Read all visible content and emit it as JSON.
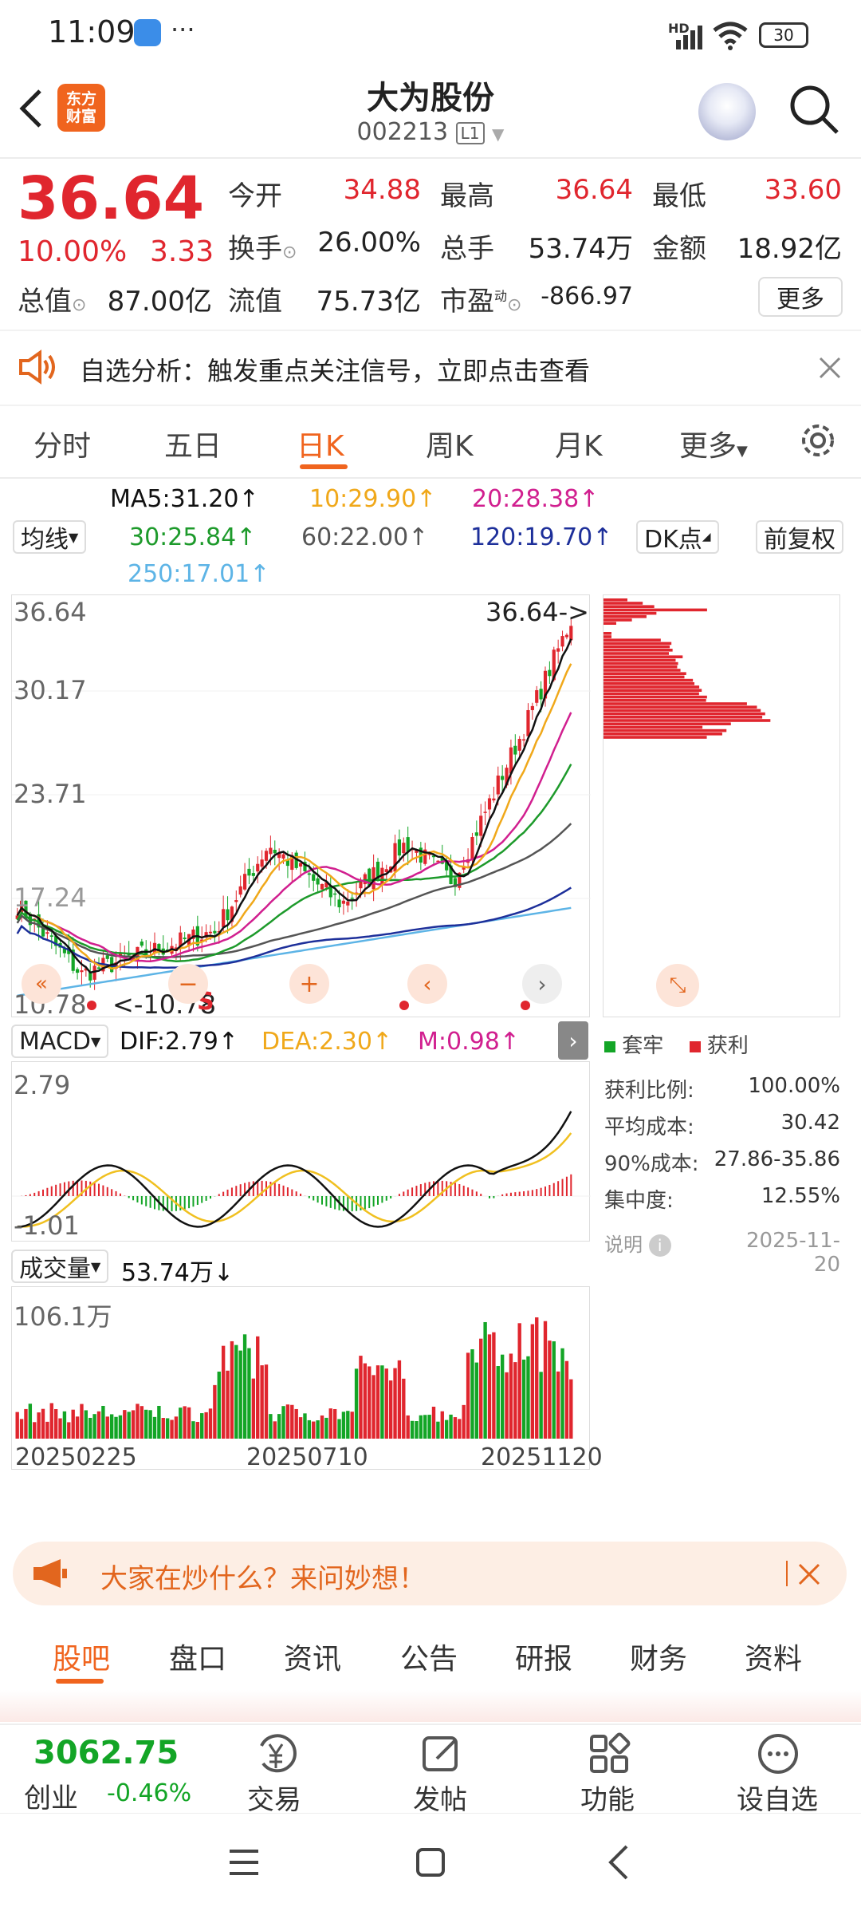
{
  "status_bar": {
    "time": "11:09",
    "more_dots": "···",
    "signal_label": "HD",
    "battery": "30"
  },
  "header": {
    "back_icon": "chevron-left-icon",
    "logo_line1": "东方",
    "logo_line2": "财富",
    "title": "大为股份",
    "code": "002213",
    "level_badge": "L1"
  },
  "quote": {
    "price": "36.64",
    "change_pct": "10.00%",
    "change": "3.33",
    "open_label": "今开",
    "open": "34.88",
    "high_label": "最高",
    "high": "36.64",
    "low_label": "最低",
    "low": "33.60",
    "turnover_label": "换手",
    "turnover": "26.00%",
    "volume_label": "总手",
    "volume": "53.74万",
    "amount_label": "金额",
    "amount": "18.92亿",
    "mcap_label": "总值",
    "mcap": "87.00亿",
    "float_label": "流值",
    "float_mcap": "75.73亿",
    "pe_label": "市盈",
    "pe_sup": "动",
    "pe": "-866.97",
    "more_label": "更多"
  },
  "banner": {
    "text": "自选分析：触发重点关注信号，立即点击查看"
  },
  "chart_tabs": {
    "items": [
      "分时",
      "五日",
      "日K",
      "周K",
      "月K",
      "更多"
    ],
    "active": "日K"
  },
  "ma_legend": {
    "selector": "均线",
    "ma5": "MA5:31.20↑",
    "ma10": "10:29.90↑",
    "ma20": "20:28.38↑",
    "ma30": "30:25.84↑",
    "ma60": "60:22.00↑",
    "ma120": "120:19.70↑",
    "ma250": "250:17.01↑",
    "dk_label": "DK点",
    "adjust_label": "前复权"
  },
  "kline": {
    "price_labels": [
      "36.64",
      "30.17",
      "23.71",
      "17.24",
      "10.78"
    ],
    "last_price_tag": "36.64->",
    "low_marker": "<-10.78",
    "signal_s": "S"
  },
  "chips": {
    "legend_trapped": "套牢",
    "legend_profit": "获利",
    "rows": [
      {
        "label": "获利比例:",
        "value": "100.00%"
      },
      {
        "label": "平均成本:",
        "value": "30.42"
      },
      {
        "label": "90%成本:",
        "value": "27.86-35.86"
      },
      {
        "label": "集中度:",
        "value": "12.55%"
      }
    ],
    "note_label": "说明",
    "date": "2025-11-20"
  },
  "macd": {
    "selector": "MACD",
    "dif": "DIF:2.79↑",
    "dea": "DEA:2.30↑",
    "m": "M:0.98↑",
    "top": "2.79",
    "bottom": "-1.01"
  },
  "volume": {
    "selector": "成交量",
    "value": "53.74万↓",
    "max_label": "106.1万",
    "dates": [
      "20250225",
      "20250710",
      "20251120"
    ]
  },
  "ask": {
    "text": "大家在炒什么？来问妙想！"
  },
  "bottom_tabs": {
    "items": [
      "股吧",
      "盘口",
      "资讯",
      "公告",
      "研报",
      "财务",
      "资料"
    ],
    "active": "股吧"
  },
  "bottom_nav": {
    "index_value": "3062.75",
    "index_name": "创业",
    "index_change": "-0.46%",
    "trade": "交易",
    "post": "发帖",
    "function": "功能",
    "watch": "设自选"
  },
  "colors": {
    "up": "#e0262e",
    "down": "#13a526",
    "accent": "#f0641e",
    "ma5": "#111111",
    "ma10": "#f0a81a",
    "ma20": "#d11f8f",
    "ma30": "#1d9a2b",
    "ma60": "#555555",
    "ma120": "#1d2f9a",
    "ma250": "#5db4e6"
  }
}
